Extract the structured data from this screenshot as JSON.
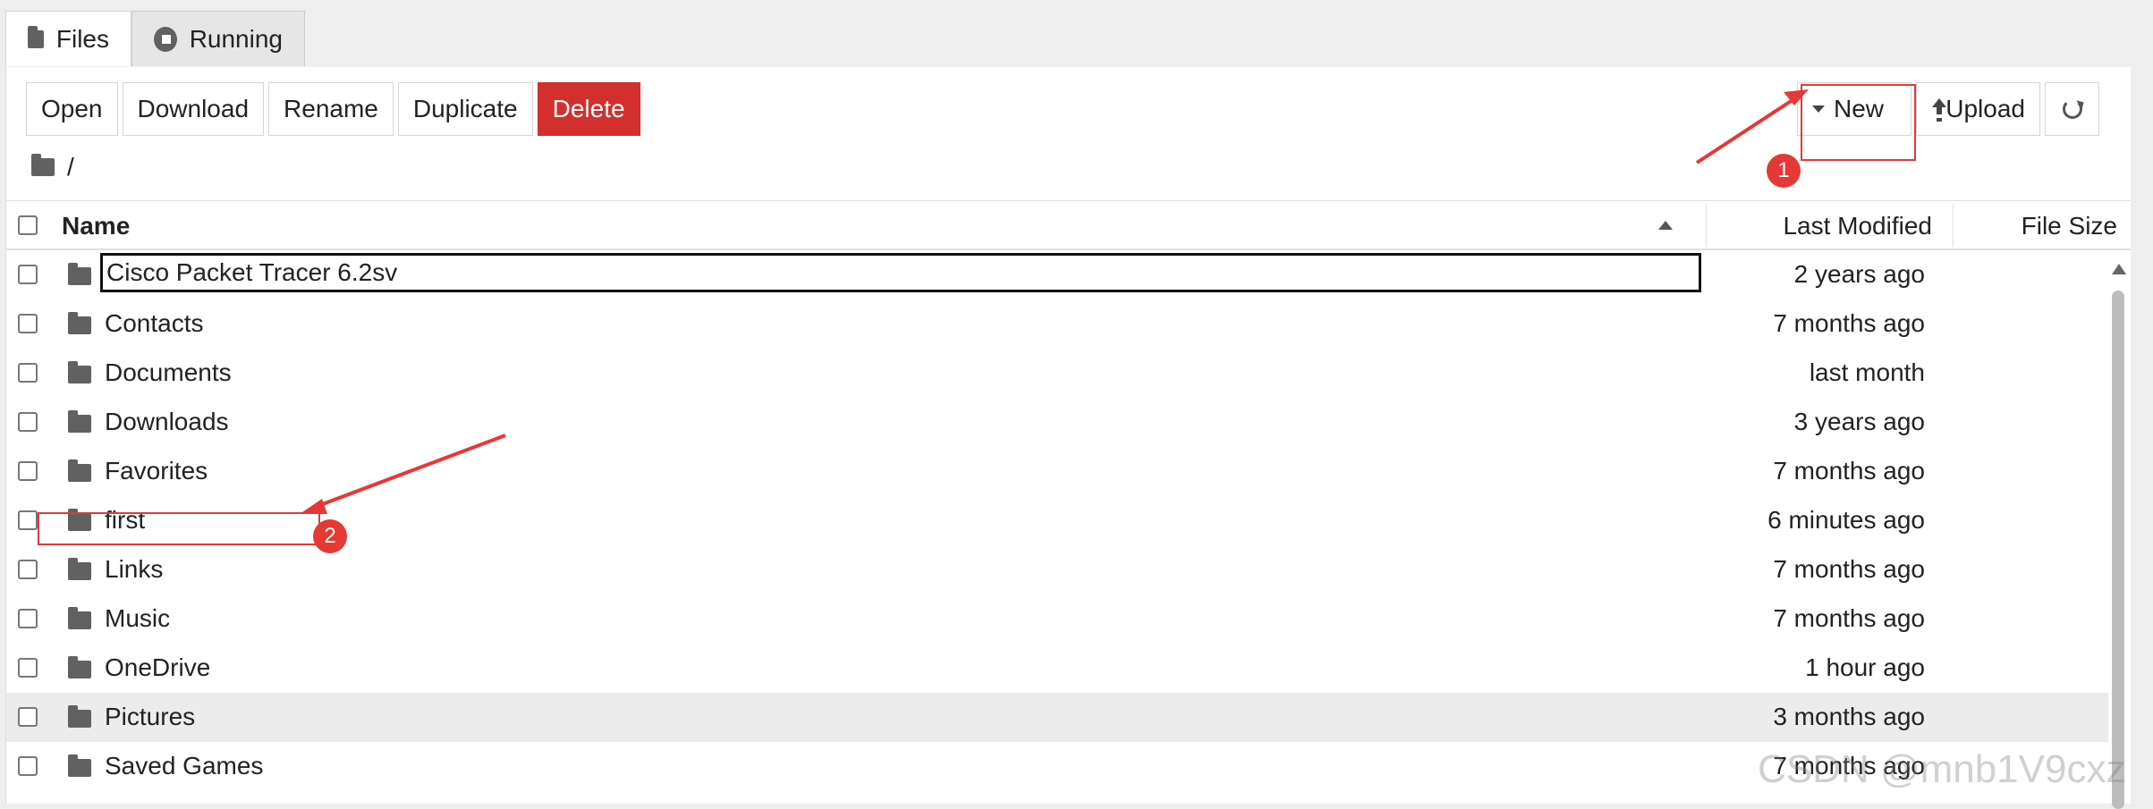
{
  "tabs": [
    {
      "label": "Files",
      "icon": "folder-icon",
      "active": true
    },
    {
      "label": "Running",
      "icon": "stop-circle-icon",
      "active": false
    }
  ],
  "toolbar": {
    "open_label": "Open",
    "download_label": "Download",
    "rename_label": "Rename",
    "duplicate_label": "Duplicate",
    "delete_label": "Delete",
    "new_label": "New",
    "upload_label": "Upload",
    "refresh_icon": "refresh-icon",
    "delete_color": "#d32f2f"
  },
  "breadcrumb": {
    "path": "/"
  },
  "table": {
    "columns": {
      "name": "Name",
      "modified": "Last Modified",
      "size": "File Size"
    },
    "sort": "ascending",
    "rows": [
      {
        "name": "Cisco Packet Tracer 6.2sv",
        "modified": "2 years ago",
        "renaming": true
      },
      {
        "name": "Contacts",
        "modified": "7 months ago"
      },
      {
        "name": "Documents",
        "modified": "last month"
      },
      {
        "name": "Downloads",
        "modified": "3 years ago"
      },
      {
        "name": "Favorites",
        "modified": "7 months ago"
      },
      {
        "name": "first",
        "modified": "6 minutes ago"
      },
      {
        "name": "Links",
        "modified": "7 months ago"
      },
      {
        "name": "Music",
        "modified": "7 months ago"
      },
      {
        "name": "OneDrive",
        "modified": "1 hour ago"
      },
      {
        "name": "Pictures",
        "modified": "3 months ago",
        "selected": true
      },
      {
        "name": "Saved Games",
        "modified": "7 months ago"
      }
    ]
  },
  "annotations": {
    "marker_1": "1",
    "marker_2": "2",
    "color": "#e53935"
  },
  "watermark": "CSDN @mnb1V9cxz"
}
